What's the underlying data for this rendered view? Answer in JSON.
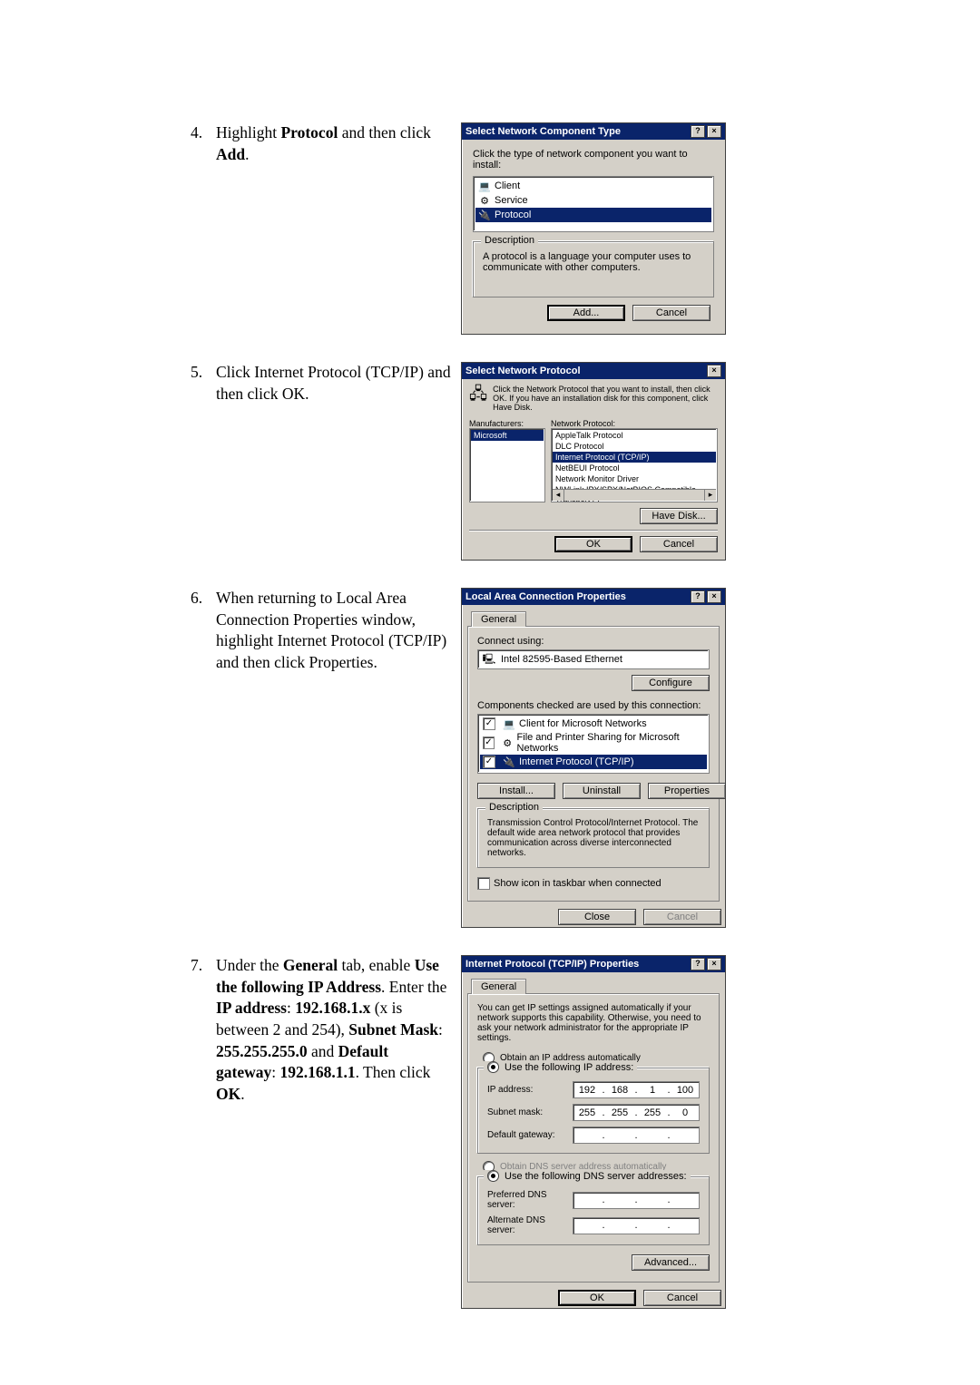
{
  "steps": {
    "s4": {
      "num": "4.",
      "text_pre": "Highlight ",
      "b1": "Protocol",
      "text_mid": " and then click ",
      "b2": "Add",
      "text_post": "."
    },
    "s5": {
      "num": "5.",
      "text": "Click Internet Protocol (TCP/IP) and then click OK."
    },
    "s6": {
      "num": "6.",
      "text": "When returning to Local Area Connection Properties window, highlight Internet Protocol (TCP/IP) and then click Properties."
    },
    "s7": {
      "num": "7.",
      "pieces": [
        "Under the ",
        "General",
        " tab, enable ",
        "Use the following IP Address",
        ". Enter the ",
        "IP address",
        ": ",
        "192.168.1.x",
        " (x is between 2 and 254), ",
        "Subnet Mask",
        ": ",
        "255.255.255.0",
        " and ",
        "Default gateway",
        ": ",
        "192.168.1.1",
        ". Then click ",
        "OK",
        "."
      ]
    }
  },
  "dlg1": {
    "title": "Select Network Component Type",
    "instr": "Click the type of network component you want to install:",
    "items": [
      "Client",
      "Service",
      "Protocol"
    ],
    "group_label": "Description",
    "desc": "A protocol is a language your computer uses to communicate with other computers.",
    "btn_add": "Add...",
    "btn_cancel": "Cancel"
  },
  "dlg2": {
    "title": "Select Network Protocol",
    "instr": "Click the Network Protocol that you want to install, then click OK. If you have an installation disk for this component, click Have Disk.",
    "col_manufacturers": "Manufacturers:",
    "col_protocol": "Network Protocol:",
    "manufacturer": "Microsoft",
    "protocols": [
      "AppleTalk Protocol",
      "DLC Protocol",
      "Internet Protocol (TCP/IP)",
      "NetBEUI Protocol",
      "Network Monitor Driver",
      "NWLink IPX/SPX/NetBIOS Compatible Transport Pr"
    ],
    "btn_havedisk": "Have Disk...",
    "btn_ok": "OK",
    "btn_cancel": "Cancel"
  },
  "dlg3": {
    "title": "Local Area Connection Properties",
    "tab": "General",
    "connect_using_label": "Connect using:",
    "adapter": "Intel 82595-Based Ethernet",
    "btn_configure": "Configure",
    "components_label": "Components checked are used by this connection:",
    "components": [
      "Client for Microsoft Networks",
      "File and Printer Sharing for Microsoft Networks",
      "Internet Protocol (TCP/IP)"
    ],
    "btn_install": "Install...",
    "btn_uninstall": "Uninstall",
    "btn_properties": "Properties",
    "group_label": "Description",
    "desc": "Transmission Control Protocol/Internet Protocol. The default wide area network protocol that provides communication across diverse interconnected networks.",
    "showicon_label": "Show icon in taskbar when connected",
    "btn_close": "Close",
    "btn_cancel": "Cancel"
  },
  "dlg4": {
    "title": "Internet Protocol (TCP/IP) Properties",
    "tab": "General",
    "intro": "You can get IP settings assigned automatically if your network supports this capability. Otherwise, you need to ask your network administrator for the appropriate IP settings.",
    "opt_auto": "Obtain an IP address automatically",
    "opt_static": "Use the following IP address:",
    "lbl_ip": "IP address:",
    "lbl_mask": "Subnet mask:",
    "lbl_gw": "Default gateway:",
    "ip": [
      "192",
      "168",
      "1",
      "100"
    ],
    "mask": [
      "255",
      "255",
      "255",
      "0"
    ],
    "gw": [
      "",
      "",
      "",
      ""
    ],
    "opt_dns_auto": "Obtain DNS server address automatically",
    "opt_dns_static": "Use the following DNS server addresses:",
    "lbl_dns1": "Preferred DNS server:",
    "lbl_dns2": "Alternate DNS server:",
    "dns1": [
      "",
      "",
      "",
      ""
    ],
    "dns2": [
      "",
      "",
      "",
      ""
    ],
    "btn_advanced": "Advanced...",
    "btn_ok": "OK",
    "btn_cancel": "Cancel"
  }
}
